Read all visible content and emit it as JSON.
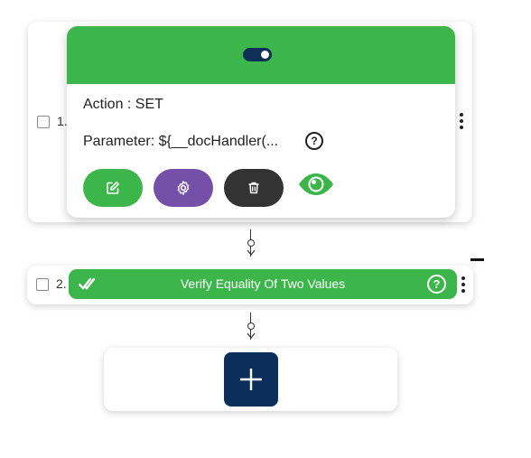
{
  "step1": {
    "number": "1.",
    "action_text": "Action : SET",
    "parameter_text": "Parameter: ${__docHandler(...",
    "help_glyph": "?",
    "toggle_on": true,
    "icons": {
      "toggle": "toggle-switch-icon",
      "edit": "edit-icon",
      "settings": "gear-icon",
      "delete": "trash-icon",
      "visibility": "eye-icon",
      "menu": "kebab-menu-icon"
    }
  },
  "step2": {
    "number": "2.",
    "title": "Verify Equality Of Two Values",
    "help_glyph": "?",
    "icons": {
      "status": "double-check-icon",
      "menu": "kebab-menu-icon"
    }
  },
  "add_step": {
    "icon": "plus-icon"
  },
  "colors": {
    "green": "#3cb54a",
    "navy": "#0b2f5a",
    "purple": "#7650a8",
    "dark": "#333333"
  }
}
